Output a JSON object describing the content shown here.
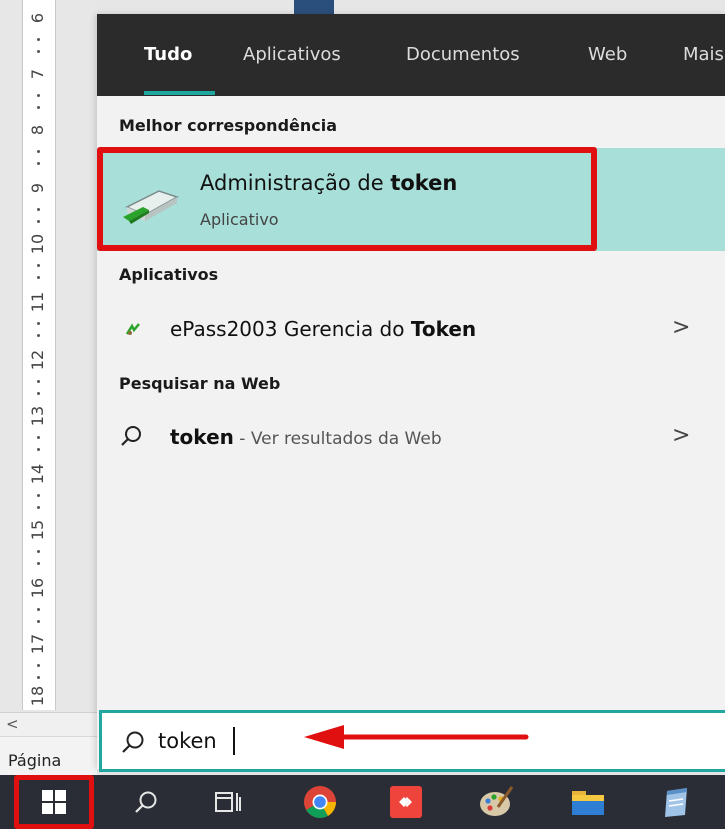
{
  "word_window": {
    "ruler_numbers": [
      "6",
      "7",
      "8",
      "9",
      "10",
      "11",
      "12",
      "13",
      "14",
      "15",
      "16",
      "17",
      "18"
    ],
    "scroll_left_glyph": "<",
    "status_page_label": "Página"
  },
  "search_panel": {
    "tabs": [
      {
        "label": "Tudo",
        "active": true
      },
      {
        "label": "Aplicativos",
        "active": false
      },
      {
        "label": "Documentos",
        "active": false
      },
      {
        "label": "Web",
        "active": false
      },
      {
        "label": "Mais",
        "active": false
      }
    ],
    "best_match": {
      "header": "Melhor correspondência",
      "title_prefix": "Administração de ",
      "title_match": "token",
      "subtitle": "Aplicativo",
      "icon": "token-admin-app-icon",
      "highlighted": true
    },
    "apps": {
      "header": "Aplicativos",
      "items": [
        {
          "prefix": "ePass2003 Gerencia do ",
          "match": "Token",
          "icon": "epass-app-icon",
          "chevron": ">"
        }
      ]
    },
    "web": {
      "header": "Pesquisar na Web",
      "items": [
        {
          "match": "token",
          "suffix": " - Ver resultados da Web",
          "icon": "search-icon",
          "chevron": ">"
        }
      ]
    },
    "search_query": "token"
  },
  "taskbar": {
    "items": [
      "windows-start-icon",
      "search-icon",
      "task-view-icon",
      "chrome-icon",
      "anydesk-icon",
      "paint-icon",
      "file-explorer-icon",
      "notepad-icon"
    ],
    "start_highlighted": true
  },
  "colors": {
    "accent_teal": "#1fa7a0",
    "highlight_bg": "#a8dfd8",
    "annotation_red": "#e01010",
    "filter_bar_bg": "#2b2b2b",
    "taskbar_bg": "#2a2d35"
  }
}
